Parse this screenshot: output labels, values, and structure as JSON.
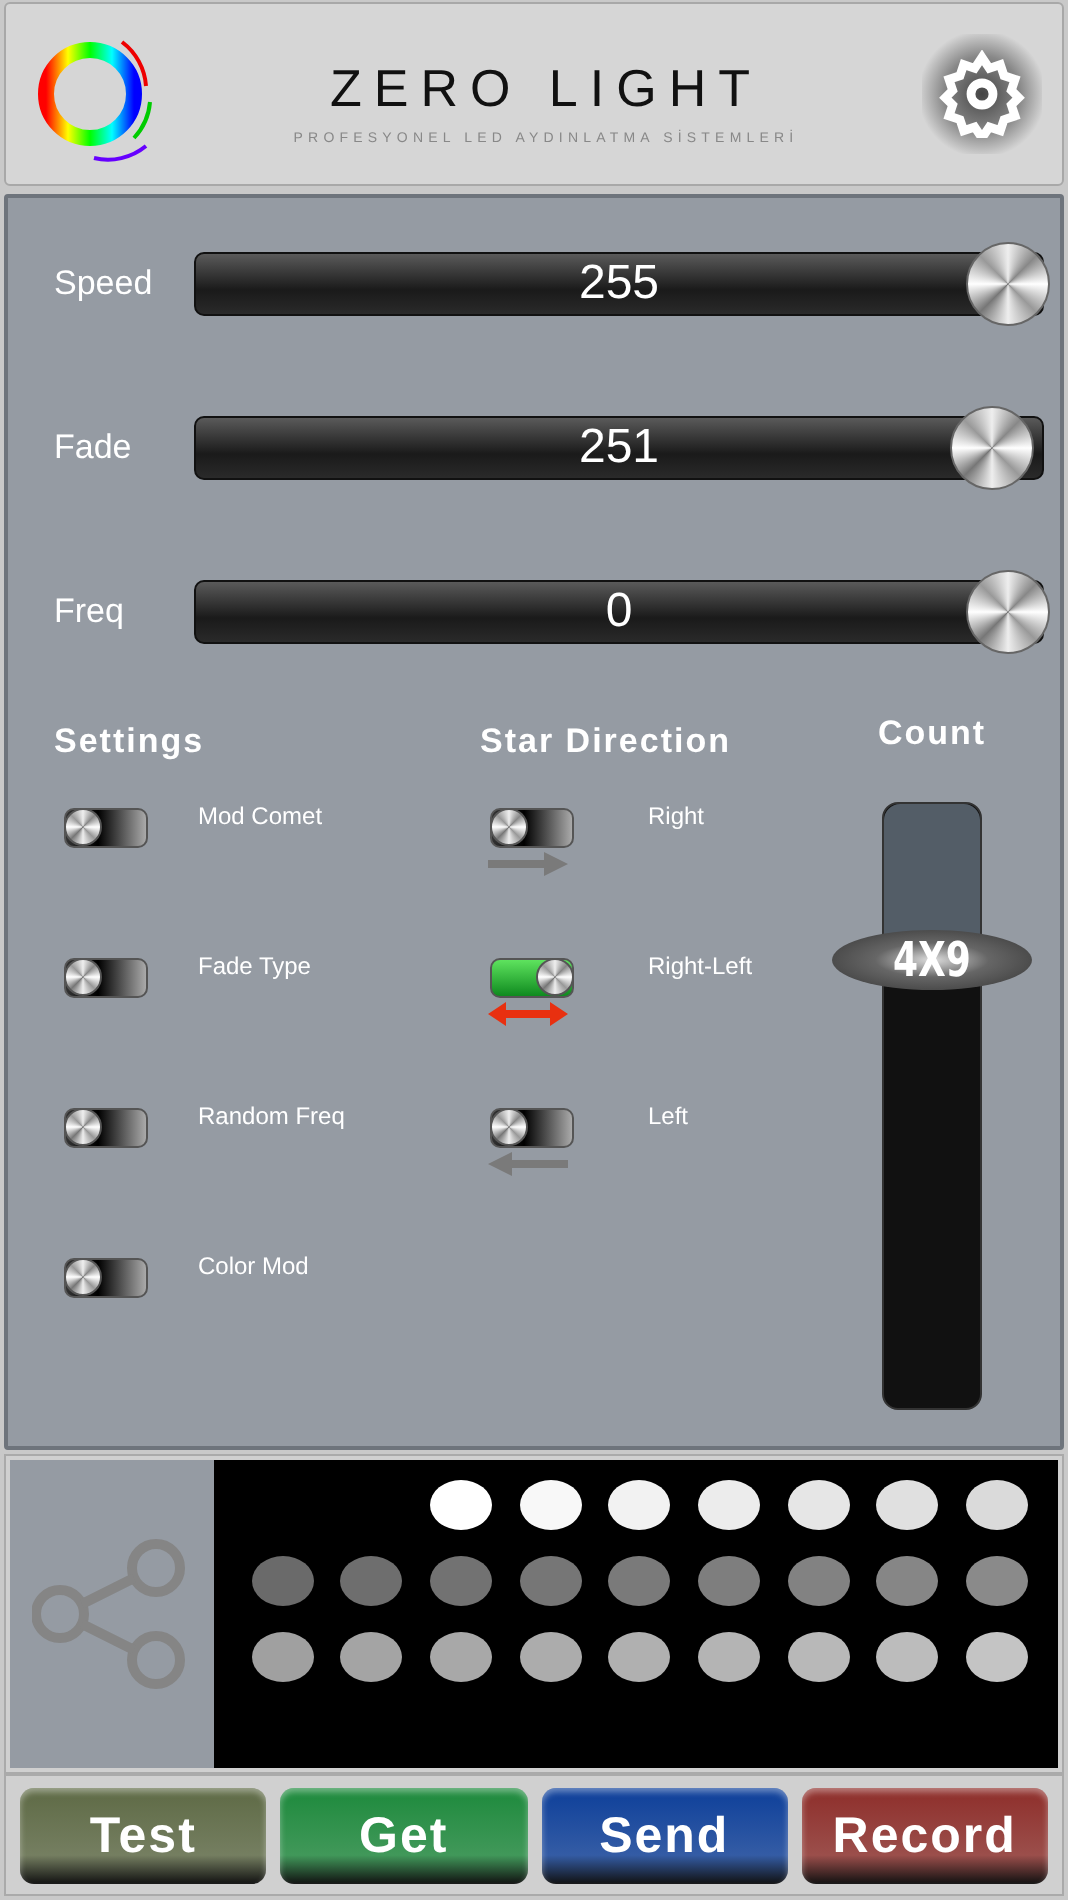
{
  "header": {
    "title": "ZERO LIGHT",
    "subtitle": "PROFESYONEL LED AYDINLATMA SİSTEMLERİ"
  },
  "sliders": [
    {
      "label": "Speed",
      "value": "255",
      "level": 1
    },
    {
      "label": "Fade",
      "value": "251",
      "level": 0.98
    },
    {
      "label": "Freq",
      "value": "0",
      "level": 1
    }
  ],
  "settings": {
    "title": "Settings",
    "items": [
      {
        "label": "Mod Comet",
        "on": false
      },
      {
        "label": "Fade Type",
        "on": false
      },
      {
        "label": "Random Freq",
        "on": false
      },
      {
        "label": "Color Mod",
        "on": false
      }
    ]
  },
  "star_direction": {
    "title": "Star Direction",
    "items": [
      {
        "label": "Right",
        "on": false,
        "kind": "right"
      },
      {
        "label": "Right-Left",
        "on": true,
        "kind": "both"
      },
      {
        "label": "Left",
        "on": false,
        "kind": "left"
      }
    ]
  },
  "count": {
    "title": "Count",
    "value": "4X9",
    "level": 0.74
  },
  "led_grid": [
    {
      "dots": [
        {
          "color": "#ffffff"
        },
        {
          "color": "#f8f8f8"
        },
        {
          "color": "#f2f2f2"
        },
        {
          "color": "#ececec"
        },
        {
          "color": "#e6e6e6"
        },
        {
          "color": "#e0e0e0"
        },
        {
          "color": "#dadada"
        }
      ]
    },
    {
      "dots": [
        {
          "color": "#6a6a6a"
        },
        {
          "color": "#6e6e6e"
        },
        {
          "color": "#727272"
        },
        {
          "color": "#767676"
        },
        {
          "color": "#7a7a7a"
        },
        {
          "color": "#7e7e7e"
        },
        {
          "color": "#828282"
        },
        {
          "color": "#868686"
        },
        {
          "color": "#8a8a8a"
        }
      ]
    },
    {
      "dots": [
        {
          "color": "#a0a0a0"
        },
        {
          "color": "#a4a4a4"
        },
        {
          "color": "#a8a8a8"
        },
        {
          "color": "#acacac"
        },
        {
          "color": "#b0b0b0"
        },
        {
          "color": "#b4b4b4"
        },
        {
          "color": "#b8b8b8"
        },
        {
          "color": "#bcbcbc"
        },
        {
          "color": "#c4c4c4"
        }
      ]
    }
  ],
  "buttons": [
    {
      "label": "Test",
      "color": "#5e6a45"
    },
    {
      "label": "Get",
      "color": "#1d8a3c"
    },
    {
      "label": "Send",
      "color": "#0d3f9a"
    },
    {
      "label": "Record",
      "color": "#8e2e2a"
    }
  ]
}
